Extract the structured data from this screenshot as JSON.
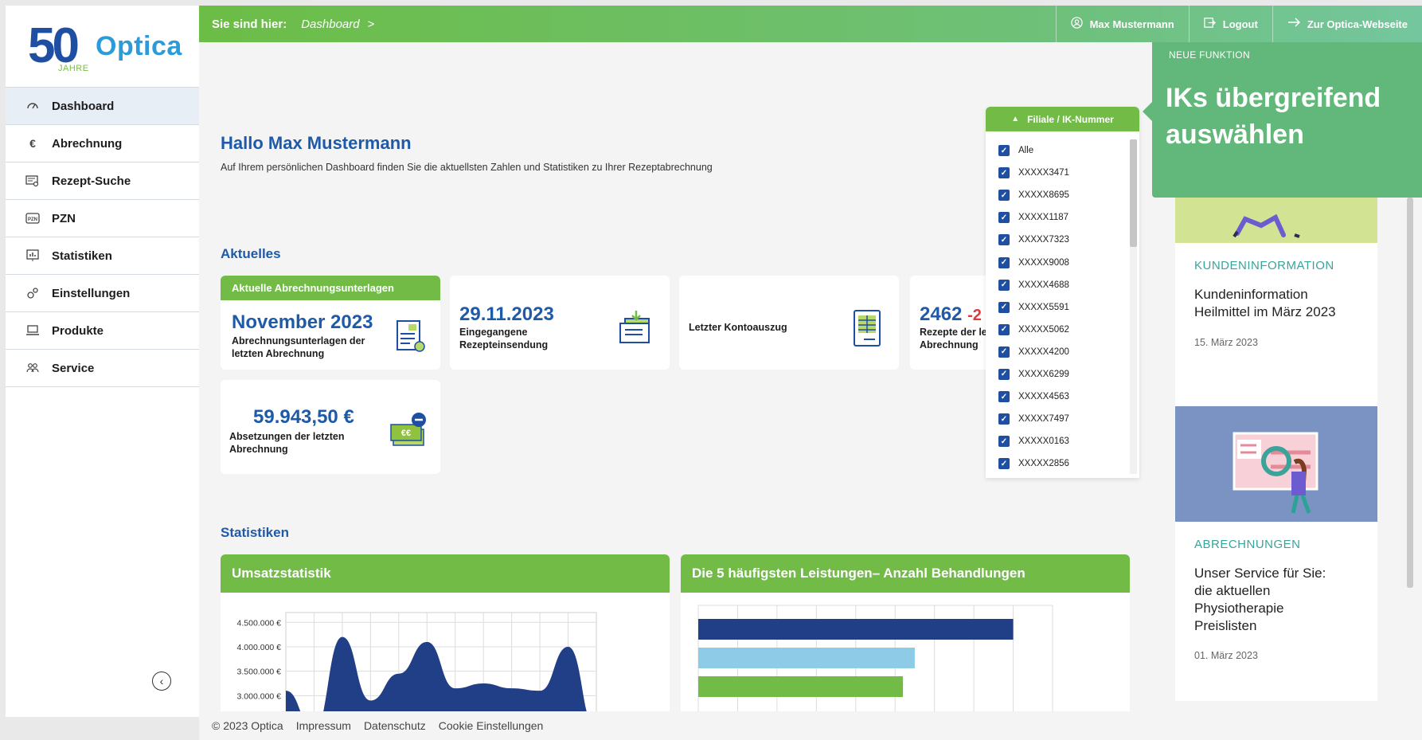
{
  "brand": {
    "logo_number": "50",
    "logo_sub": "JAHRE",
    "logo_name": "Optica"
  },
  "sidebar": {
    "items": [
      {
        "label": "Dashboard",
        "icon": "gauge-icon",
        "active": true
      },
      {
        "label": "Abrechnung",
        "icon": "euro-icon"
      },
      {
        "label": "Rezept-Suche",
        "icon": "receipt-search-icon"
      },
      {
        "label": "PZN",
        "icon": "pzn-icon"
      },
      {
        "label": "Statistiken",
        "icon": "chart-icon"
      },
      {
        "label": "Einstellungen",
        "icon": "gears-icon"
      },
      {
        "label": "Produkte",
        "icon": "laptop-icon"
      },
      {
        "label": "Service",
        "icon": "users-icon"
      }
    ],
    "collapse_icon": "‹"
  },
  "topbar": {
    "breadcrumb_label": "Sie sind hier:",
    "breadcrumb_current": "Dashboard",
    "breadcrumb_sep": ">",
    "user": "Max Mustermann",
    "logout": "Logout",
    "website": "Zur Optica-Webseite"
  },
  "main": {
    "greeting": "Hallo Max Mustermann",
    "greeting_sub": "Auf Ihrem persönlichen Dashboard finden Sie die aktuellsten Zahlen und Statistiken zu Ihrer Rezeptabrechnung",
    "section_news": "Aktuelles",
    "section_stats": "Statistiken",
    "cards": {
      "docs_header": "Aktuelle Abrechnungsunterlagen",
      "docs_value": "November 2023",
      "docs_caption": "Abrechnungsunterlagen der letzten Abrechnung",
      "date_value": "29.11.2023",
      "date_caption": "Eingegangene Rezepteinsendung",
      "statement_caption": "Letzter Kontoauszug",
      "recipes_value": "2462",
      "recipes_delta": "-2",
      "recipes_caption": "Rezepte der letzten Abrechnung",
      "deduction_value": "59.943,50 €",
      "deduction_caption": "Absetzungen der letzten Abrechnung"
    }
  },
  "dropdown": {
    "title": "Filiale / IK-Nummer",
    "options": [
      "Alle",
      "XXXXX3471",
      "XXXXX8695",
      "XXXXX1187",
      "XXXXX7323",
      "XXXXX9008",
      "XXXXX4688",
      "XXXXX5591",
      "XXXXX5062",
      "XXXXX4200",
      "XXXXX6299",
      "XXXXX4563",
      "XXXXX7497",
      "XXXXX0163",
      "XXXXX2856"
    ]
  },
  "tooltip": {
    "kicker": "NEUE FUNKTION",
    "title": "IKs übergreifend auswählen"
  },
  "news": [
    {
      "category": "KUNDENINFORMATION",
      "title": "Kundeninformation Heilmittel im März 2023",
      "date": "15. März 2023"
    },
    {
      "category": "ABRECHNUNGEN",
      "title": "Unser Service für Sie: die aktuellen Physiotherapie Preislisten",
      "date": "01. März 2023"
    }
  ],
  "footer": {
    "copyright": "© 2023 Optica",
    "links": [
      "Impressum",
      "Datenschutz",
      "Cookie Einstellungen"
    ]
  },
  "colors": {
    "green": "#72bb47",
    "blue": "#1e5aa8",
    "navy": "#213f86",
    "light_blue": "#8ecbe7",
    "teal": "#3aa39a"
  },
  "chart_data": [
    {
      "type": "area",
      "title": "Umsatzstatistik",
      "y_tick_labels": [
        "4.500.000 €",
        "4.000.000 €",
        "3.500.000 €",
        "3.000.000 €"
      ],
      "ylim": [
        2500000,
        4700000
      ],
      "x": [
        0,
        1,
        2,
        3,
        4,
        5,
        6,
        7,
        8,
        9,
        10,
        11
      ],
      "values": [
        3100000,
        2300000,
        4200000,
        2900000,
        3450000,
        4100000,
        3150000,
        3250000,
        3150000,
        3100000,
        4000000,
        2300000
      ],
      "grid": true
    },
    {
      "type": "bar",
      "orientation": "horizontal",
      "title": "Die 5 häufigsten Leistungen– Anzahl Behandlungen",
      "values": [
        80,
        55,
        52
      ],
      "colors": [
        "#213f86",
        "#8ecbe7",
        "#72bb47"
      ],
      "xlim": [
        0,
        90
      ],
      "grid": true
    }
  ]
}
